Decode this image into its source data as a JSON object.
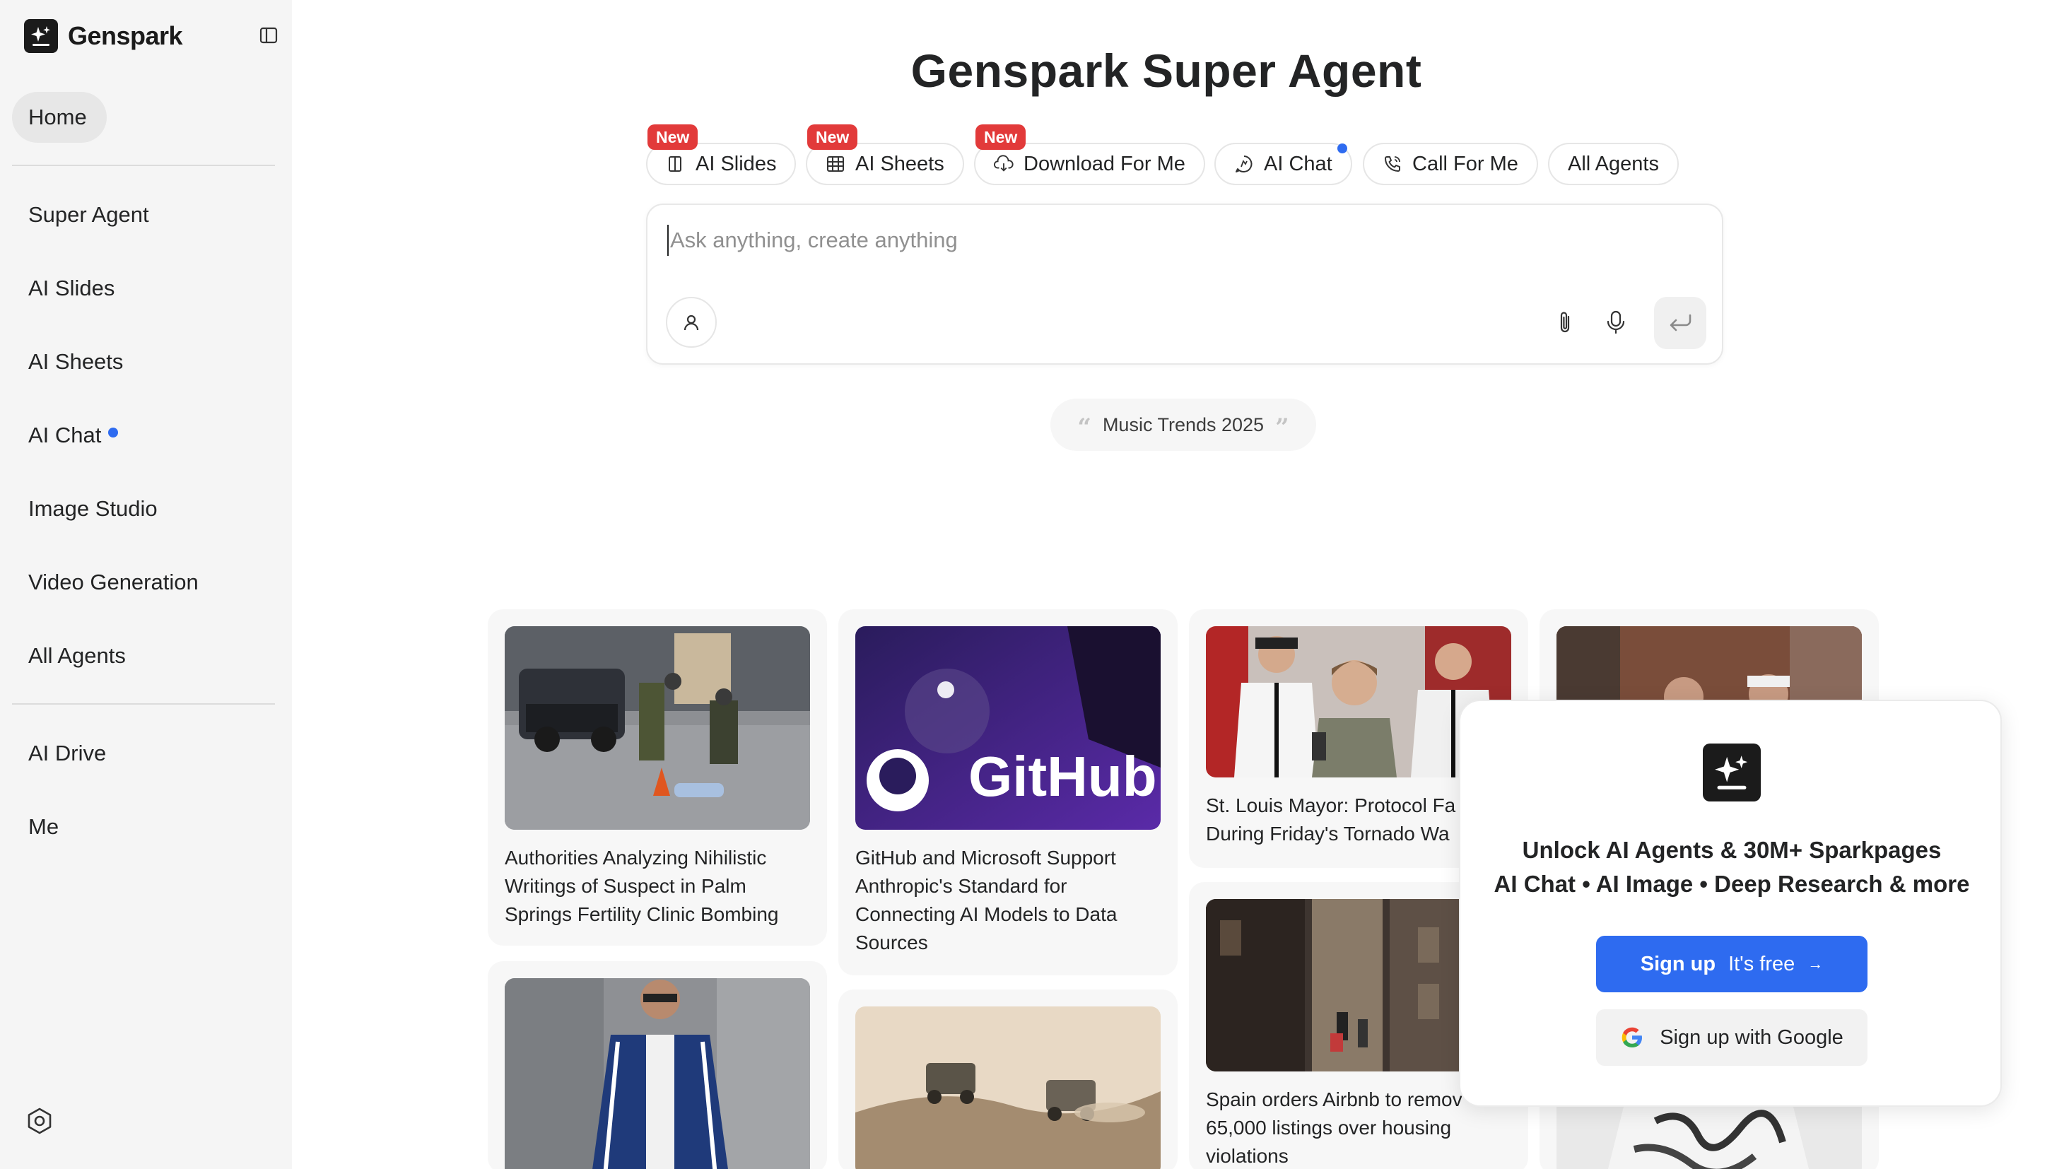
{
  "brand": {
    "name": "Genspark"
  },
  "sidebar": {
    "home": "Home",
    "items": [
      {
        "label": "Super Agent"
      },
      {
        "label": "AI Slides"
      },
      {
        "label": "AI Sheets"
      },
      {
        "label": "AI Chat",
        "dot": true
      },
      {
        "label": "Image Studio"
      },
      {
        "label": "Video Generation"
      },
      {
        "label": "All Agents"
      }
    ],
    "items2": [
      {
        "label": "AI Drive"
      },
      {
        "label": "Me"
      }
    ]
  },
  "main": {
    "title": "Genspark Super Agent",
    "chips": [
      {
        "label": "AI Slides",
        "icon": "slides-icon",
        "badge": "New"
      },
      {
        "label": "AI Sheets",
        "icon": "sheets-icon",
        "badge": "New"
      },
      {
        "label": "Download For Me",
        "icon": "cloud-download-icon",
        "badge": "New"
      },
      {
        "label": "AI Chat",
        "icon": "chat-icon",
        "dot": true
      },
      {
        "label": "Call For Me",
        "icon": "phone-icon"
      },
      {
        "label": "All Agents"
      }
    ],
    "prompt": {
      "placeholder": "Ask anything, create anything",
      "value": ""
    },
    "suggestion": "Music Trends 2025"
  },
  "cards": [
    {
      "title": "Authorities Analyzing Nihilistic Writings of Suspect in Palm Springs Fertility Clinic Bombing"
    },
    {
      "title": "GitHub and Microsoft Support Anthropic's Standard for Connecting AI Models to Data Sources",
      "image_text": "GitHub"
    },
    {
      "title": "St. Louis Mayor: Protocol Fa During Friday's Tornado Wa"
    },
    {
      "title": "Spain orders Airbnb to remov 65,000 listings over housing violations"
    },
    {
      "title": ""
    },
    {
      "title": ""
    },
    {
      "title": ""
    },
    {
      "title": ""
    }
  ],
  "modal": {
    "headline": "Unlock AI Agents & 30M+ Sparkpages",
    "sub": "AI Chat • AI Image • Deep Research & more",
    "signup_bold": "Sign up",
    "signup_free": "It's free",
    "signup_arrow": "→",
    "google": "Sign up with Google"
  },
  "colors": {
    "accent": "#2e6bf0",
    "badge": "#e23a3a",
    "sidebar_bg": "#f5f5f5"
  }
}
